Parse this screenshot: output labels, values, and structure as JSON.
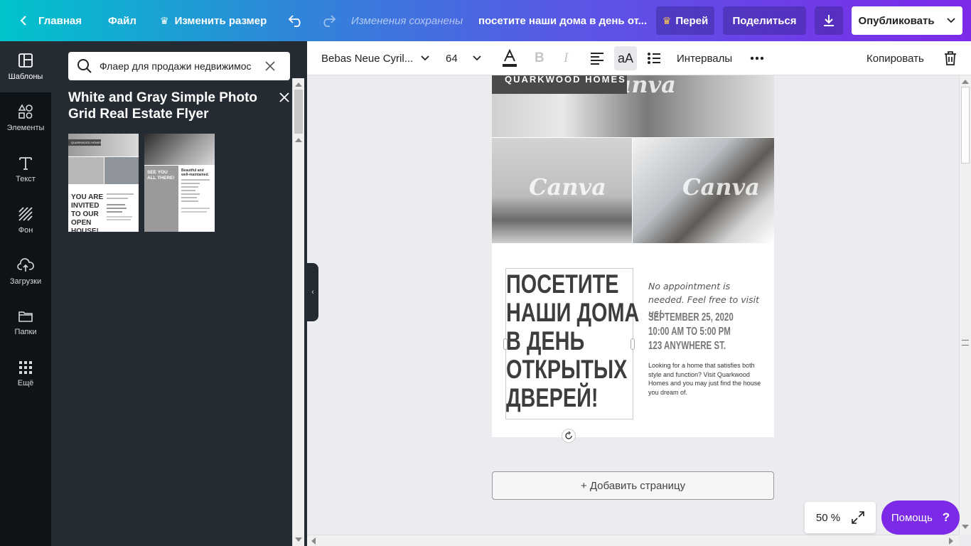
{
  "topbar": {
    "home": "Главная",
    "file": "Файл",
    "resize": "Изменить размер",
    "saved_status": "Изменения сохранены",
    "doc_title": "посетите наши дома в день от...",
    "upgrade": "Перей",
    "share": "Поделиться",
    "publish": "Опубликовать"
  },
  "rail": [
    {
      "label": "Шаблоны",
      "icon": "templates-icon"
    },
    {
      "label": "Элементы",
      "icon": "elements-icon"
    },
    {
      "label": "Текст",
      "icon": "text-icon"
    },
    {
      "label": "Фон",
      "icon": "background-icon"
    },
    {
      "label": "Загрузки",
      "icon": "upload-icon"
    },
    {
      "label": "Папки",
      "icon": "folder-icon"
    },
    {
      "label": "Ещё",
      "icon": "more-grid-icon"
    }
  ],
  "panel": {
    "search_value": "Флаер для продажи недвижимос",
    "title": "White and Gray Simple Photo Grid Real Estate Flyer",
    "thumb1": {
      "brand": "QUARKWOOD HOMES",
      "headline": "YOU ARE INVITED TO OUR OPEN HOUSE!"
    },
    "thumb2": {
      "headline": "SEE YOU ALL THERE!",
      "subhead": "Beautiful and well-maintained."
    }
  },
  "format": {
    "font": "Bebas Neue Cyril...",
    "size": "64",
    "spacing": "Интервалы",
    "copy": "Копировать"
  },
  "design": {
    "brand": "QUARKWOOD HOMES",
    "watermark": "Canva",
    "headline": [
      "ПОСЕТИТЕ",
      "НАШИ ДОМА",
      "В ДЕНЬ",
      "ОТКРЫТЫХ",
      "ДВЕРЕЙ!"
    ],
    "no_appointment": "No appointment is needed. Feel free to visit us!",
    "date": "SEPTEMBER 25, 2020",
    "time": "10:00 AM TO 5:00 PM",
    "address": "123 ANYWHERE ST.",
    "description": "Looking for a home that satisfies both style and function? Visit Quarkwood Homes and you may just find the house you dream of."
  },
  "canvas": {
    "add_page": "+ Добавить страницу",
    "zoom": "50 %",
    "help": "Помощь"
  }
}
